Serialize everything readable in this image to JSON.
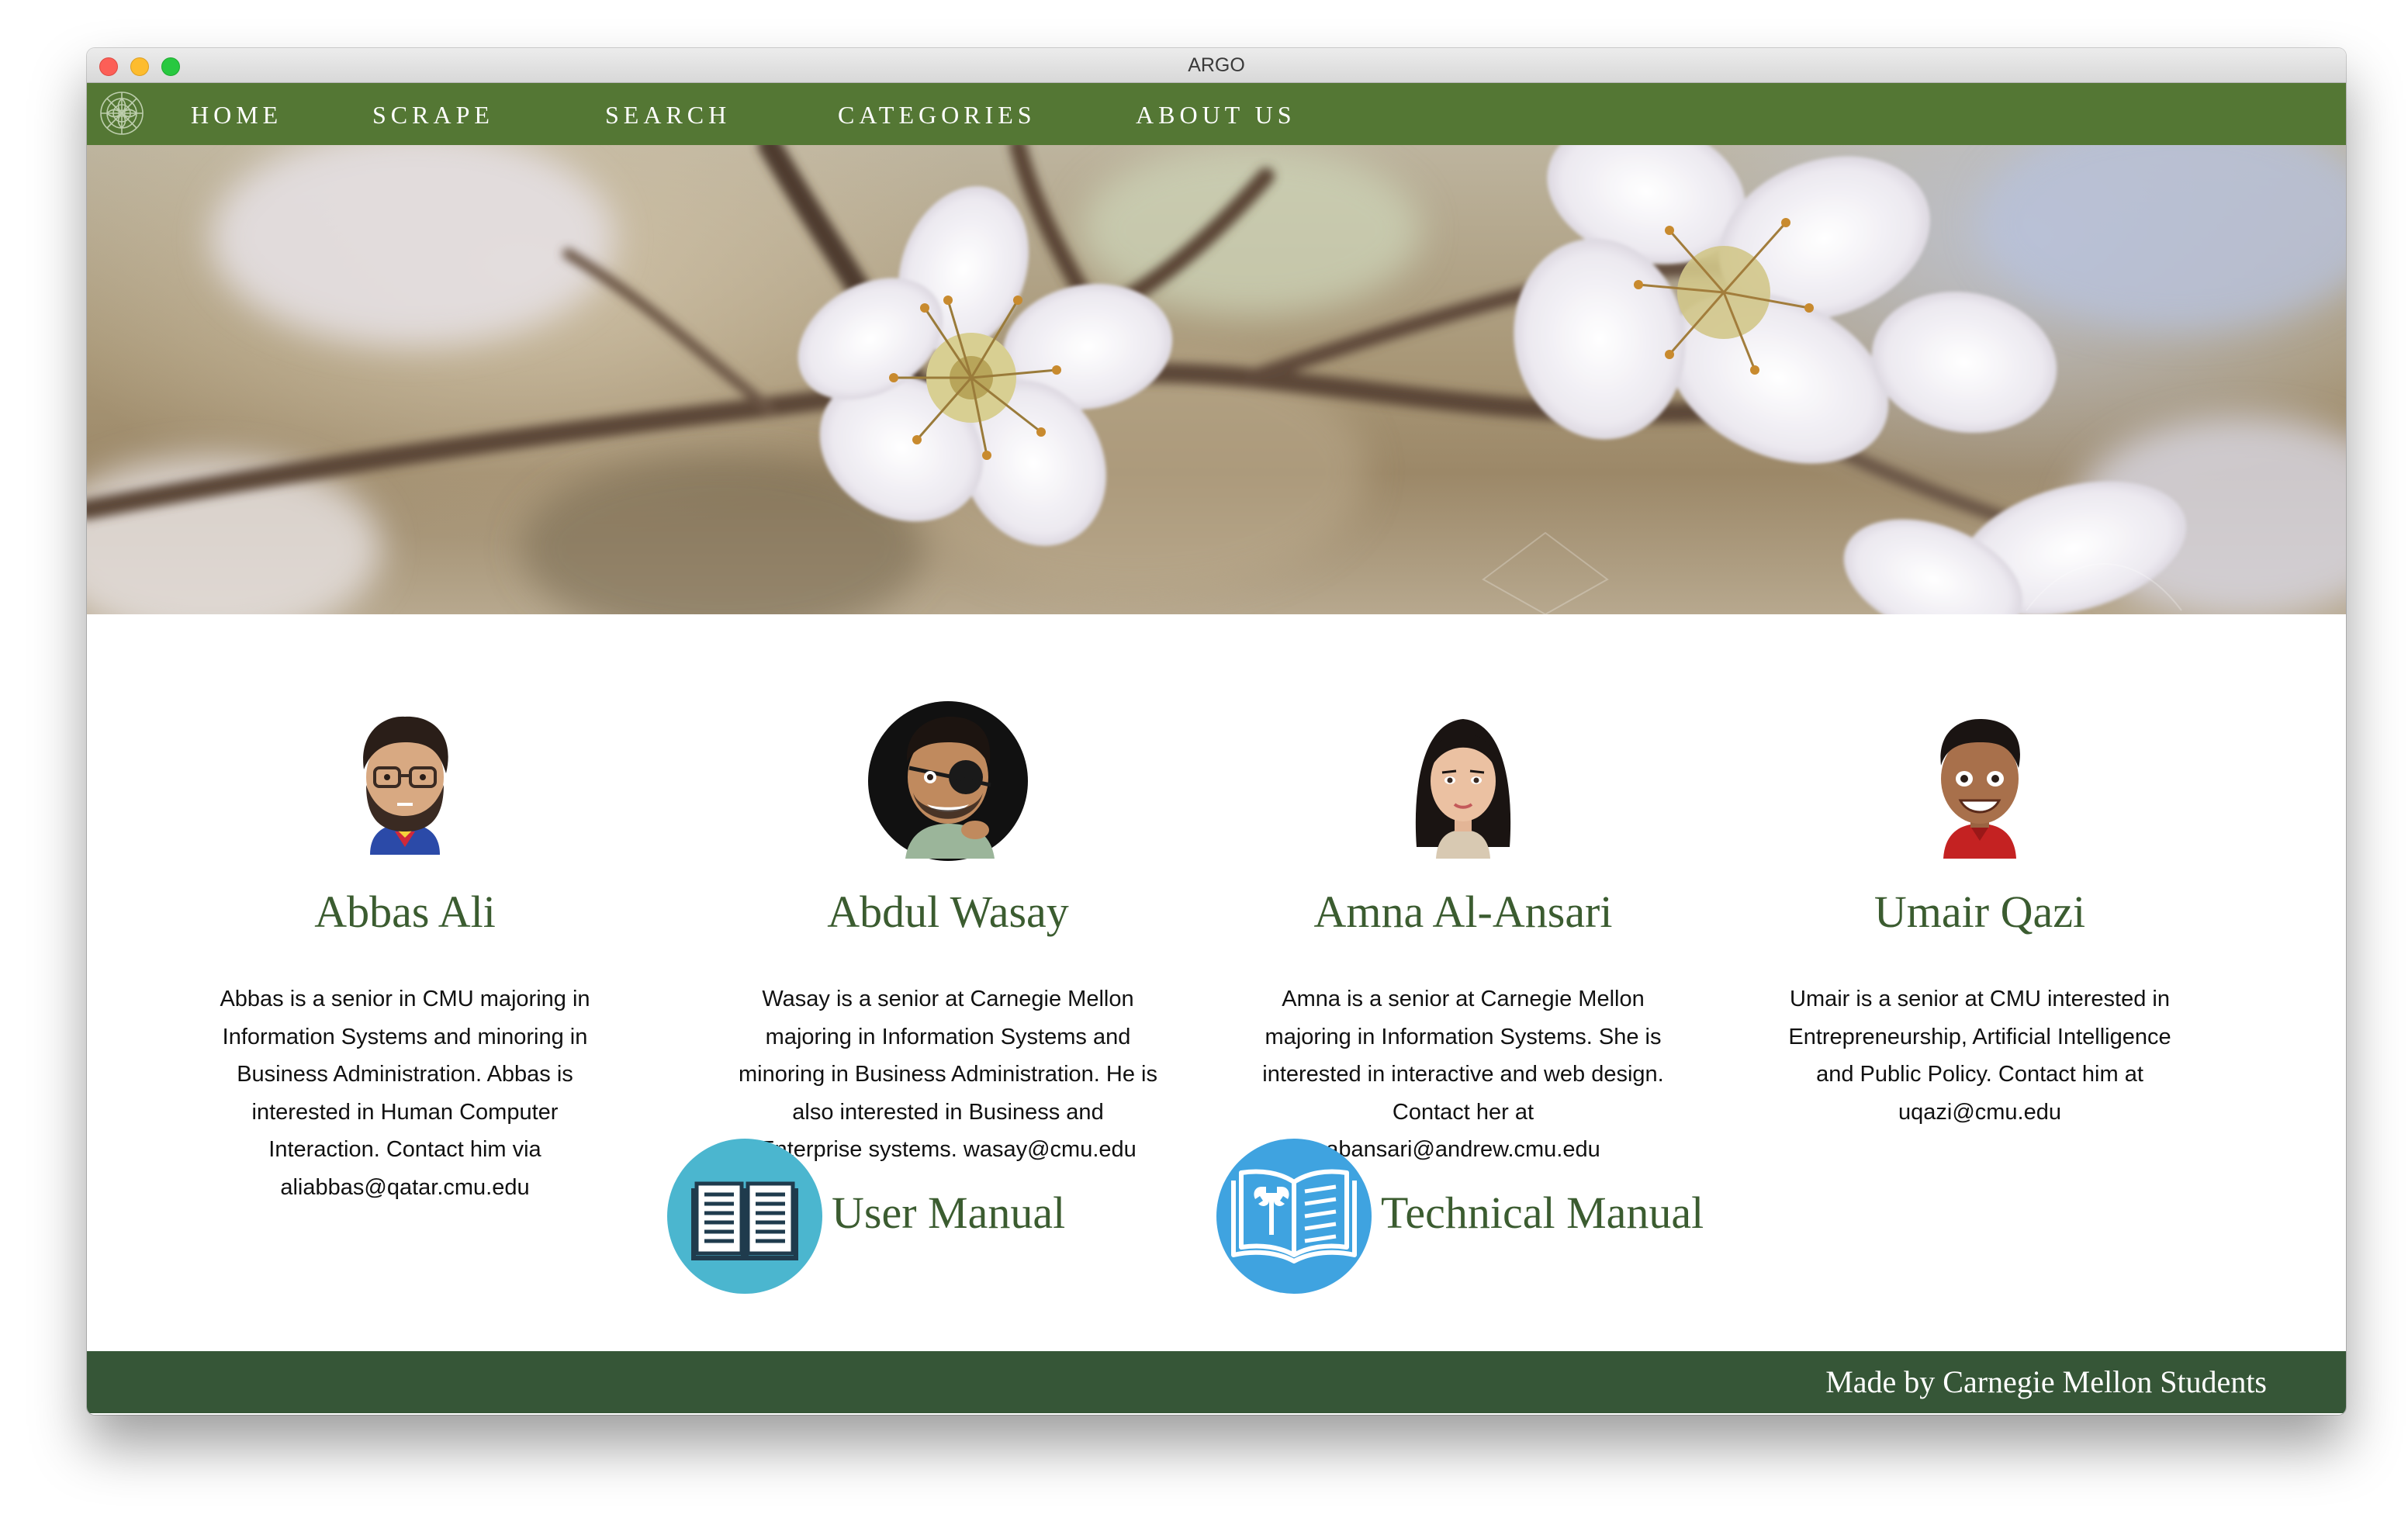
{
  "window": {
    "title": "ARGO"
  },
  "nav": {
    "logo_icon": "mandala-logo-icon",
    "items": [
      {
        "label": "HOME"
      },
      {
        "label": "SCRAPE"
      },
      {
        "label": "SEARCH"
      },
      {
        "label": "CATEGORIES"
      },
      {
        "label": "ABOUT US"
      }
    ]
  },
  "team": [
    {
      "name": "Abbas Ali",
      "avatar_icon": "bearded-man-glasses-avatar-icon",
      "bio": "Abbas is a senior in CMU majoring in Information Systems and minoring in Business Administration. Abbas is interested in Human Computer Interaction. Contact him via aliabbas@qatar.cmu.edu"
    },
    {
      "name": "Abdul Wasay",
      "avatar_icon": "eyepatch-man-avatar-icon",
      "bio": "Wasay is a senior at Carnegie Mellon majoring in Information Systems and minoring in Business Administration. He is also interested in Business and Enterprise systems. wasay@cmu.edu"
    },
    {
      "name": "Amna Al-Ansari",
      "avatar_icon": "woman-avatar-icon",
      "bio": "Amna is a senior at Carnegie Mellon majoring in Information Systems. She is interested in interactive and web design. Contact her at abansari@andrew.cmu.edu"
    },
    {
      "name": "Umair Qazi",
      "avatar_icon": "smiling-man-avatar-icon",
      "bio": "Umair is a senior at CMU interested in Entrepreneurship, Artificial Intelligence and Public Policy. Contact him at uqazi@cmu.edu"
    }
  ],
  "manuals": [
    {
      "label": "User Manual",
      "icon": "open-book-icon"
    },
    {
      "label": "Technical Manual",
      "icon": "book-wrench-icon"
    }
  ],
  "footer": {
    "text": "Made by Carnegie Mellon Students"
  },
  "colors": {
    "nav_bg": "#547734",
    "footer_bg": "#365637",
    "heading": "#3b5c30",
    "user_manual_icon_bg": "#4bb6cf",
    "technical_manual_icon_bg": "#3fa3e0"
  }
}
